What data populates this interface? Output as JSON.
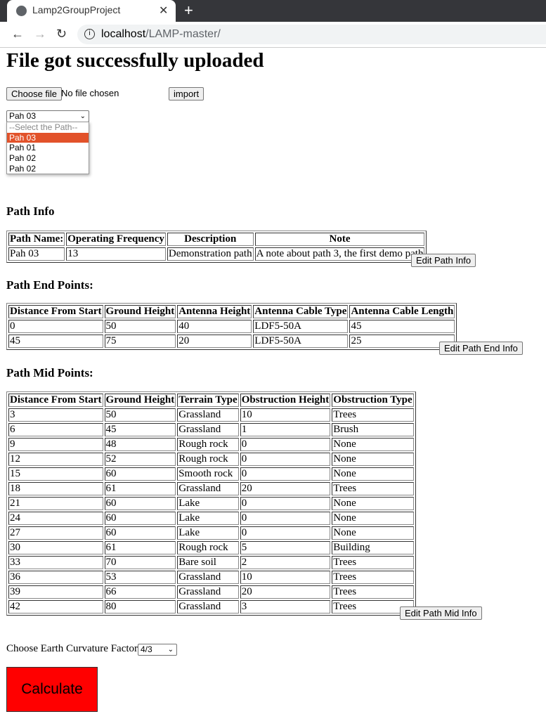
{
  "browser": {
    "tab_title": "Lamp2GroupProject",
    "url_host": "localhost",
    "url_path": "/LAMP-master/"
  },
  "page_title": "File got successfully uploaded",
  "upload": {
    "choose_label": "Choose file",
    "no_file": "No file chosen",
    "import_label": "import"
  },
  "path_select": {
    "selected": "Pah 03",
    "options": [
      "--Select the Path--",
      "Pah 03",
      "Pah 01",
      "Pah 02",
      "Pah 02"
    ]
  },
  "path_info": {
    "heading": "Path Info",
    "headers": [
      "Path Name:",
      "Operating Frequency",
      "Description",
      "Note"
    ],
    "rows": [
      [
        "Pah 03",
        "13",
        "Demonstration path",
        "A note about path 3, the first demo path"
      ]
    ],
    "edit_label": "Edit Path Info"
  },
  "end_points": {
    "heading": "Path End Points:",
    "headers": [
      "Distance From Start",
      "Ground Height",
      "Antenna Height",
      "Antenna Cable Type",
      "Antenna Cable Length"
    ],
    "rows": [
      [
        "0",
        "50",
        "40",
        "LDF5-50A",
        "45"
      ],
      [
        "45",
        "75",
        "20",
        "LDF5-50A",
        "25"
      ]
    ],
    "edit_label": "Edit Path End Info"
  },
  "mid_points": {
    "heading": "Path Mid Points:",
    "headers": [
      "Distance From Start",
      "Ground Height",
      "Terrain Type",
      "Obstruction Height",
      "Obstruction Type"
    ],
    "rows": [
      [
        "3",
        "50",
        "Grassland",
        "10",
        "Trees"
      ],
      [
        "6",
        "45",
        "Grassland",
        "1",
        "Brush"
      ],
      [
        "9",
        "48",
        "Rough rock",
        "0",
        "None"
      ],
      [
        "12",
        "52",
        "Rough rock",
        "0",
        "None"
      ],
      [
        "15",
        "60",
        "Smooth rock",
        "0",
        "None"
      ],
      [
        "18",
        "61",
        "Grassland",
        "20",
        "Trees"
      ],
      [
        "21",
        "60",
        "Lake",
        "0",
        "None"
      ],
      [
        "24",
        "60",
        "Lake",
        "0",
        "None"
      ],
      [
        "27",
        "60",
        "Lake",
        "0",
        "None"
      ],
      [
        "30",
        "61",
        "Rough rock",
        "5",
        "Building"
      ],
      [
        "33",
        "70",
        "Bare soil",
        "2",
        "Trees"
      ],
      [
        "36",
        "53",
        "Grassland",
        "10",
        "Trees"
      ],
      [
        "39",
        "66",
        "Grassland",
        "20",
        "Trees"
      ],
      [
        "42",
        "80",
        "Grassland",
        "3",
        "Trees"
      ]
    ],
    "edit_label": "Edit Path Mid Info"
  },
  "curvature": {
    "label": "Choose Earth Curvature Factor:",
    "selected": "4/3"
  },
  "calculate_label": "Calculate"
}
